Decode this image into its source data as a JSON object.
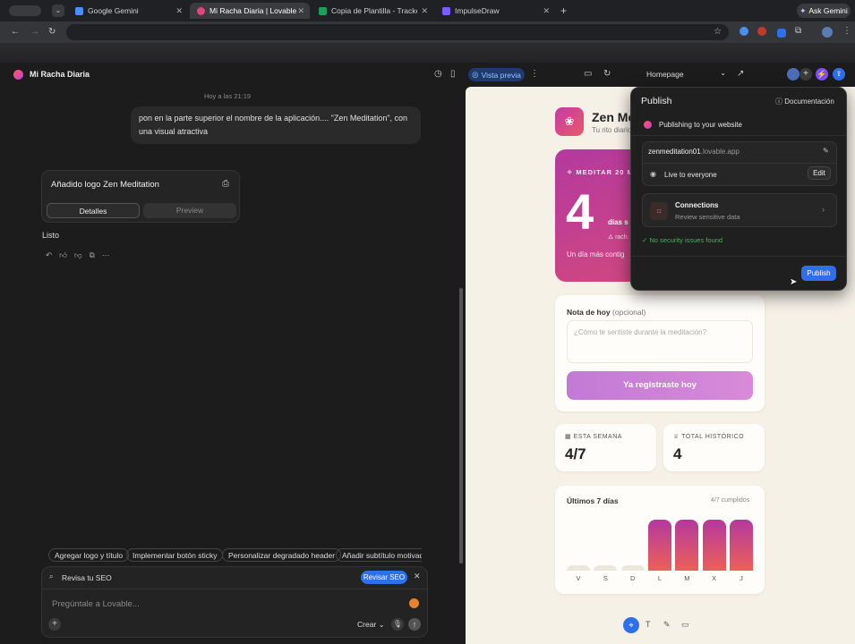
{
  "browser": {
    "tabs": [
      {
        "label": "Google Gemini",
        "color": "#4c8df6"
      },
      {
        "label": "Mi Racha Diaria | Lovable",
        "color": "#e0457b"
      },
      {
        "label": "Copia de Plantilla - Tracker de",
        "color": "#1e9e5a"
      },
      {
        "label": "ImpulseDraw",
        "color": "#7b5cff"
      }
    ],
    "ask_gemini": "Ask Gemini"
  },
  "app": {
    "project_name": "Mi Racha Diaria",
    "vista_previa": "Vista previa",
    "page_select": "Homepage"
  },
  "chat": {
    "timestamp": "Hoy a las 21:19",
    "user_message": "pon en la parte superior el nombre de la aplicación.... \"Zen Meditation\", con una visual atractiva",
    "card_title": "Añadido logo Zen Meditation",
    "card_tab_details": "Detalles",
    "card_tab_preview": "Preview",
    "reply": "Listo",
    "suggestions": [
      "Agregar logo y título",
      "Implementar botón sticky",
      "Personalizar degradado header",
      "Añadir subtítulo motivado"
    ],
    "seo_label": "Revisa tu SEO",
    "seo_button": "Revisar SEO",
    "composer_placeholder": "Pregúntale a Lovable...",
    "crear_label": "Crear"
  },
  "preview": {
    "app_title": "Zen Me",
    "app_subtitle": "Tu rito diario",
    "streak_header": "MEDITAR 20 M",
    "streak_number": "4",
    "streak_days": "días s",
    "streak_user": "rach",
    "streak_footer": "Un día más contig",
    "note_label": "Nota de hoy",
    "note_optional": "(opcional)",
    "note_placeholder": "¿Cómo te sentiste durante la meditación?",
    "register_button": "Ya registraste hoy",
    "week_label": "ESTA SEMANA",
    "week_value": "4/7",
    "total_label": "TOTAL HISTÓRICO",
    "total_value": "4",
    "chart_title": "Últimos 7 días",
    "chart_summary": "4/7 cumplidos"
  },
  "chart_data": {
    "type": "bar",
    "categories": [
      "V",
      "S",
      "D",
      "L",
      "M",
      "X",
      "J"
    ],
    "values": [
      0,
      0,
      0,
      1,
      1,
      1,
      1
    ],
    "title": "Últimos 7 días",
    "ylim": [
      0,
      1
    ]
  },
  "publish": {
    "title": "Publish",
    "docs": "Documentación",
    "subtitle": "Publishing to your website",
    "domain_main": "zenmeditation01",
    "domain_suffix": ".lovable.app",
    "visibility": "Live to everyone",
    "edit": "Edit",
    "connections_title": "Connections",
    "connections_sub": "Review sensitive data",
    "security": "No security issues found",
    "publish_button": "Publish"
  },
  "colors": {
    "accent_blue": "#2f6fea",
    "gradient_start": "#b3399f",
    "gradient_end": "#ec5f58",
    "success": "#3fb950"
  }
}
